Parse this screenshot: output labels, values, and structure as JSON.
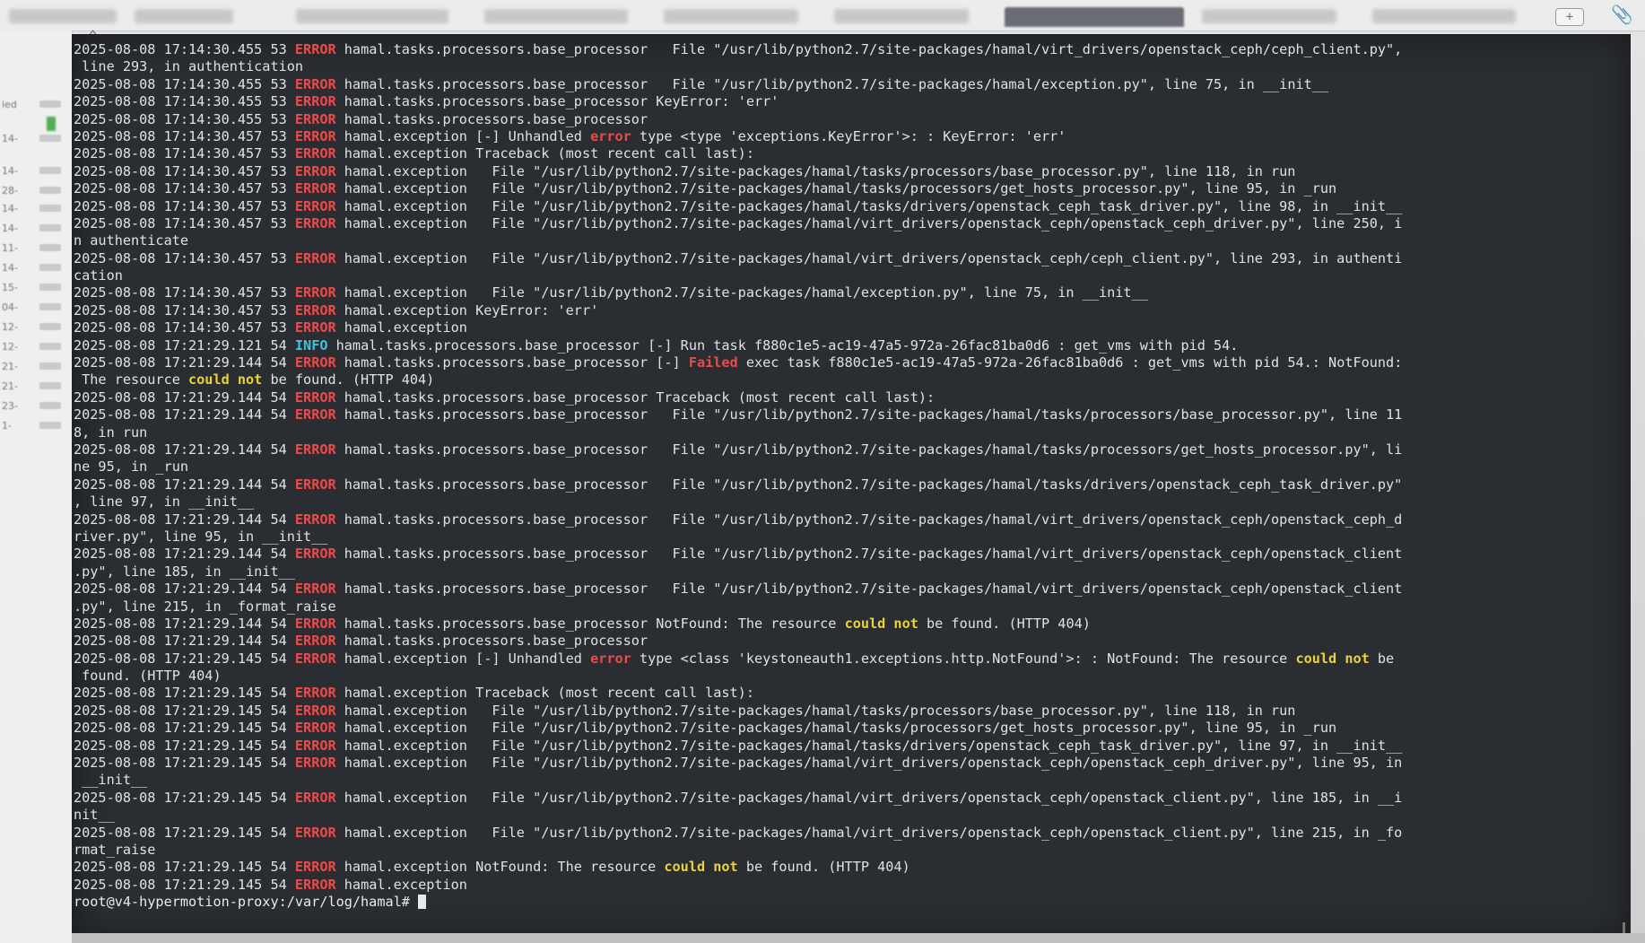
{
  "ui": {
    "new_tab_icon": "plus-icon",
    "attach_icon": "paperclip-icon",
    "home_icon": "home-icon"
  },
  "sidebar": {
    "items": [
      {
        "label": "ied"
      },
      {
        "label": "14-"
      },
      {
        "label": "14-"
      },
      {
        "label": "28-"
      },
      {
        "label": "14-"
      },
      {
        "label": "14-"
      },
      {
        "label": "11-"
      },
      {
        "label": "14-"
      },
      {
        "label": "15-"
      },
      {
        "label": "04-"
      },
      {
        "label": "12-"
      },
      {
        "label": "12-"
      },
      {
        "label": "21-"
      },
      {
        "label": "21-"
      },
      {
        "label": "23-"
      },
      {
        "label": "1-"
      }
    ]
  },
  "terminal": {
    "lines": [
      {
        "ts": "2025-08-08 17:14:30.455 53",
        "level": "ERROR",
        "module": "hamal.tasks.processors.base_processor",
        "msg": "   File \"/usr/lib/python2.7/site-packages/hamal/virt_drivers/openstack_ceph/ceph_client.py\","
      },
      {
        "cont": " line 293, in authentication"
      },
      {
        "ts": "2025-08-08 17:14:30.455 53",
        "level": "ERROR",
        "module": "hamal.tasks.processors.base_processor",
        "msg": "   File \"/usr/lib/python2.7/site-packages/hamal/exception.py\", line 75, in __init__"
      },
      {
        "ts": "2025-08-08 17:14:30.455 53",
        "level": "ERROR",
        "module": "hamal.tasks.processors.base_processor",
        "msg": " KeyError: 'err'"
      },
      {
        "ts": "2025-08-08 17:14:30.455 53",
        "level": "ERROR",
        "module": "hamal.tasks.processors.base_processor",
        "msg": ""
      },
      {
        "ts": "2025-08-08 17:14:30.457 53",
        "level": "ERROR",
        "module": "hamal.exception",
        "msg_pre": " [-] Unhandled ",
        "msg_hl": "error",
        "hl": "red",
        "msg_post": " type <type 'exceptions.KeyError'>: : KeyError: 'err'"
      },
      {
        "ts": "2025-08-08 17:14:30.457 53",
        "level": "ERROR",
        "module": "hamal.exception",
        "msg": " Traceback (most recent call last):"
      },
      {
        "ts": "2025-08-08 17:14:30.457 53",
        "level": "ERROR",
        "module": "hamal.exception",
        "msg": "   File \"/usr/lib/python2.7/site-packages/hamal/tasks/processors/base_processor.py\", line 118, in run"
      },
      {
        "ts": "2025-08-08 17:14:30.457 53",
        "level": "ERROR",
        "module": "hamal.exception",
        "msg": "   File \"/usr/lib/python2.7/site-packages/hamal/tasks/processors/get_hosts_processor.py\", line 95, in _run"
      },
      {
        "ts": "2025-08-08 17:14:30.457 53",
        "level": "ERROR",
        "module": "hamal.exception",
        "msg": "   File \"/usr/lib/python2.7/site-packages/hamal/tasks/drivers/openstack_ceph_task_driver.py\", line 98, in __init__"
      },
      {
        "ts": "2025-08-08 17:14:30.457 53",
        "level": "ERROR",
        "module": "hamal.exception",
        "msg": "   File \"/usr/lib/python2.7/site-packages/hamal/virt_drivers/openstack_ceph/openstack_ceph_driver.py\", line 250, i"
      },
      {
        "cont": "n authenticate"
      },
      {
        "ts": "2025-08-08 17:14:30.457 53",
        "level": "ERROR",
        "module": "hamal.exception",
        "msg": "   File \"/usr/lib/python2.7/site-packages/hamal/virt_drivers/openstack_ceph/ceph_client.py\", line 293, in authenti"
      },
      {
        "cont": "cation"
      },
      {
        "ts": "2025-08-08 17:14:30.457 53",
        "level": "ERROR",
        "module": "hamal.exception",
        "msg": "   File \"/usr/lib/python2.7/site-packages/hamal/exception.py\", line 75, in __init__"
      },
      {
        "ts": "2025-08-08 17:14:30.457 53",
        "level": "ERROR",
        "module": "hamal.exception",
        "msg": " KeyError: 'err'"
      },
      {
        "ts": "2025-08-08 17:14:30.457 53",
        "level": "ERROR",
        "module": "hamal.exception",
        "msg": ""
      },
      {
        "ts": "2025-08-08 17:21:29.121 54",
        "level": "INFO",
        "module": "hamal.tasks.processors.base_processor",
        "msg": " [-] Run task f880c1e5-ac19-47a5-972a-26fac81ba0d6 : get_vms with pid 54."
      },
      {
        "ts": "2025-08-08 17:21:29.144 54",
        "level": "ERROR",
        "module": "hamal.tasks.processors.base_processor",
        "msg_pre": " [-] ",
        "msg_hl": "Failed",
        "hl": "red",
        "msg_post": " exec task f880c1e5-ac19-47a5-972a-26fac81ba0d6 : get_vms with pid 54.: NotFound:"
      },
      {
        "cont_pre": " The resource ",
        "cont_hl": "could not",
        "cont_post": " be found. (HTTP 404)"
      },
      {
        "ts": "2025-08-08 17:21:29.144 54",
        "level": "ERROR",
        "module": "hamal.tasks.processors.base_processor",
        "msg": " Traceback (most recent call last):"
      },
      {
        "ts": "2025-08-08 17:21:29.144 54",
        "level": "ERROR",
        "module": "hamal.tasks.processors.base_processor",
        "msg": "   File \"/usr/lib/python2.7/site-packages/hamal/tasks/processors/base_processor.py\", line 11"
      },
      {
        "cont": "8, in run"
      },
      {
        "ts": "2025-08-08 17:21:29.144 54",
        "level": "ERROR",
        "module": "hamal.tasks.processors.base_processor",
        "msg": "   File \"/usr/lib/python2.7/site-packages/hamal/tasks/processors/get_hosts_processor.py\", li"
      },
      {
        "cont": "ne 95, in _run"
      },
      {
        "ts": "2025-08-08 17:21:29.144 54",
        "level": "ERROR",
        "module": "hamal.tasks.processors.base_processor",
        "msg": "   File \"/usr/lib/python2.7/site-packages/hamal/tasks/drivers/openstack_ceph_task_driver.py\""
      },
      {
        "cont": ", line 97, in __init__"
      },
      {
        "ts": "2025-08-08 17:21:29.144 54",
        "level": "ERROR",
        "module": "hamal.tasks.processors.base_processor",
        "msg": "   File \"/usr/lib/python2.7/site-packages/hamal/virt_drivers/openstack_ceph/openstack_ceph_d"
      },
      {
        "cont": "river.py\", line 95, in __init__"
      },
      {
        "ts": "2025-08-08 17:21:29.144 54",
        "level": "ERROR",
        "module": "hamal.tasks.processors.base_processor",
        "msg": "   File \"/usr/lib/python2.7/site-packages/hamal/virt_drivers/openstack_ceph/openstack_client"
      },
      {
        "cont": ".py\", line 185, in __init__"
      },
      {
        "ts": "2025-08-08 17:21:29.144 54",
        "level": "ERROR",
        "module": "hamal.tasks.processors.base_processor",
        "msg": "   File \"/usr/lib/python2.7/site-packages/hamal/virt_drivers/openstack_ceph/openstack_client"
      },
      {
        "cont": ".py\", line 215, in _format_raise"
      },
      {
        "ts": "2025-08-08 17:21:29.144 54",
        "level": "ERROR",
        "module": "hamal.tasks.processors.base_processor",
        "msg_pre": " NotFound: The resource ",
        "msg_hl": "could not",
        "hl": "yellow",
        "msg_post": " be found. (HTTP 404)"
      },
      {
        "ts": "2025-08-08 17:21:29.144 54",
        "level": "ERROR",
        "module": "hamal.tasks.processors.base_processor",
        "msg": ""
      },
      {
        "ts": "2025-08-08 17:21:29.145 54",
        "level": "ERROR",
        "module": "hamal.exception",
        "msg_pre": " [-] Unhandled ",
        "msg_hl": "error",
        "hl": "red",
        "msg_post": " type <class 'keystoneauth1.exceptions.http.NotFound'>: : NotFound: The resource ",
        "msg_hl2": "could not",
        "msg_post2": " be"
      },
      {
        "cont": " found. (HTTP 404)"
      },
      {
        "ts": "2025-08-08 17:21:29.145 54",
        "level": "ERROR",
        "module": "hamal.exception",
        "msg": " Traceback (most recent call last):"
      },
      {
        "ts": "2025-08-08 17:21:29.145 54",
        "level": "ERROR",
        "module": "hamal.exception",
        "msg": "   File \"/usr/lib/python2.7/site-packages/hamal/tasks/processors/base_processor.py\", line 118, in run"
      },
      {
        "ts": "2025-08-08 17:21:29.145 54",
        "level": "ERROR",
        "module": "hamal.exception",
        "msg": "   File \"/usr/lib/python2.7/site-packages/hamal/tasks/processors/get_hosts_processor.py\", line 95, in _run"
      },
      {
        "ts": "2025-08-08 17:21:29.145 54",
        "level": "ERROR",
        "module": "hamal.exception",
        "msg": "   File \"/usr/lib/python2.7/site-packages/hamal/tasks/drivers/openstack_ceph_task_driver.py\", line 97, in __init__"
      },
      {
        "ts": "2025-08-08 17:21:29.145 54",
        "level": "ERROR",
        "module": "hamal.exception",
        "msg": "   File \"/usr/lib/python2.7/site-packages/hamal/virt_drivers/openstack_ceph/openstack_ceph_driver.py\", line 95, in"
      },
      {
        "cont": " __init__"
      },
      {
        "ts": "2025-08-08 17:21:29.145 54",
        "level": "ERROR",
        "module": "hamal.exception",
        "msg": "   File \"/usr/lib/python2.7/site-packages/hamal/virt_drivers/openstack_ceph/openstack_client.py\", line 185, in __i"
      },
      {
        "cont": "nit__"
      },
      {
        "ts": "2025-08-08 17:21:29.145 54",
        "level": "ERROR",
        "module": "hamal.exception",
        "msg": "   File \"/usr/lib/python2.7/site-packages/hamal/virt_drivers/openstack_ceph/openstack_client.py\", line 215, in _fo"
      },
      {
        "cont": "rmat_raise"
      },
      {
        "ts": "2025-08-08 17:21:29.145 54",
        "level": "ERROR",
        "module": "hamal.exception",
        "msg_pre": " NotFound: The resource ",
        "msg_hl": "could not",
        "hl": "yellow",
        "msg_post": " be found. (HTTP 404)"
      },
      {
        "ts": "2025-08-08 17:21:29.145 54",
        "level": "ERROR",
        "module": "hamal.exception",
        "msg": ""
      }
    ],
    "prompt": "root@v4-hypermotion-proxy:/var/log/hamal# "
  },
  "colors": {
    "terminal_bg": "#2a2d31",
    "text": "#dfe2e4",
    "error": "#ef4a4a",
    "info": "#3fc3d8",
    "highlight": "#e9d23a"
  }
}
